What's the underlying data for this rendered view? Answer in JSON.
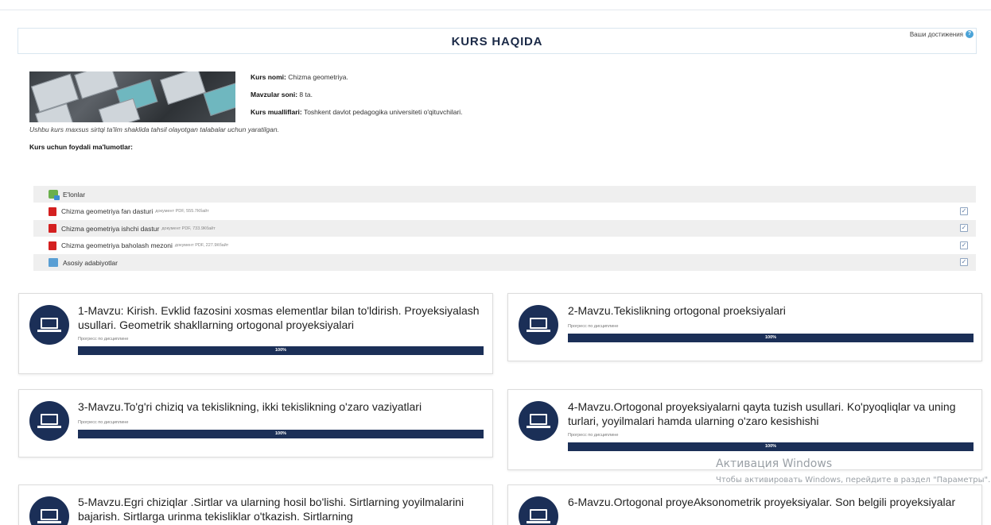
{
  "header": {
    "title": "KURS HAQIDA",
    "achievements": "Ваши достижения",
    "help_icon": "question-circle-icon"
  },
  "course_info": {
    "name_label": "Kurs nomi:",
    "name_value": "Chizma geometriya.",
    "topics_label": "Mavzular soni:",
    "topics_value": "8 ta.",
    "authors_label": "Kurs mualliflari:",
    "authors_value": "Toshkent davlot pedagogika universiteti o'qituvchilari.",
    "description": "Ushbu kurs maxsus sirtqi ta'lim shaklida tahsil olayotgan talabalar uchun yaratilgan.",
    "useful_title": "Kurs uchun foydali ma'lumotlar:"
  },
  "resources": [
    {
      "icon": "forum-icon",
      "label": "E'lonlar",
      "meta": "",
      "checkbox": false
    },
    {
      "icon": "pdf-icon",
      "label": "Chizma geometriya fan dasturi",
      "meta": "документ PDF, 555.7Кбайт",
      "checkbox": true
    },
    {
      "icon": "pdf-icon",
      "label": "Chizma geometriya ishchi dastur",
      "meta": "документ PDF, 733.9Кбайт",
      "checkbox": true
    },
    {
      "icon": "pdf-icon",
      "label": "Chizma geometriya baholash mezoni",
      "meta": "документ PDF, 227.9Кбайт",
      "checkbox": true
    },
    {
      "icon": "folder-icon",
      "label": "Asosiy adabiyotlar",
      "meta": "",
      "checkbox": true
    }
  ],
  "check_mark": "✓",
  "topic_cards": [
    {
      "title": "1-Mavzu: Kirish. Evklid fazosini xosmas elementlar bilan to'ldirish. Proyeksiyalash usullari. Geometrik shakllarning ortogonal proyeksiyalari",
      "progress_label": "Прогресс по дисциплине",
      "progress": 100,
      "progress_text": "100%"
    },
    {
      "title": "2-Mavzu.Tekislikning ortogonal proeksiyalari",
      "progress_label": "Прогресс по дисциплине",
      "progress": 100,
      "progress_text": "100%"
    },
    {
      "title": "3-Mavzu.To'g'ri chiziq va tekislikning, ikki tekislikning o'zaro vaziyatlari",
      "progress_label": "Прогресс по дисциплине",
      "progress": 100,
      "progress_text": "100%"
    },
    {
      "title": "4-Mavzu.Ortogonal proyeksiyalarni qayta tuzish usullari. Ko'pyoqliqlar va uning turlari, yoyilmalari hamda ularning o'zaro kesishishi",
      "progress_label": "Прогресс по дисциплине",
      "progress": 100,
      "progress_text": "100%"
    },
    {
      "title": "5-Mavzu.Egri chiziqlar .Sirtlar va ularning hosil bo'lishi. Sirtlarning yoyilmalarini bajarish. Sirtlarga urinma tekisliklar o'tkazish. Sirtlarning",
      "progress_label": "",
      "progress": null,
      "progress_text": ""
    },
    {
      "title": "6-Mavzu.Ortogonal proyeAksonometrik proyeksiyalar. Son belgili proyeksiyalar",
      "progress_label": "",
      "progress": null,
      "progress_text": ""
    }
  ],
  "watermark": {
    "title": "Активация Windows",
    "text": "Чтобы активировать Windows, перейдите в раздел \"Параметры\"."
  }
}
